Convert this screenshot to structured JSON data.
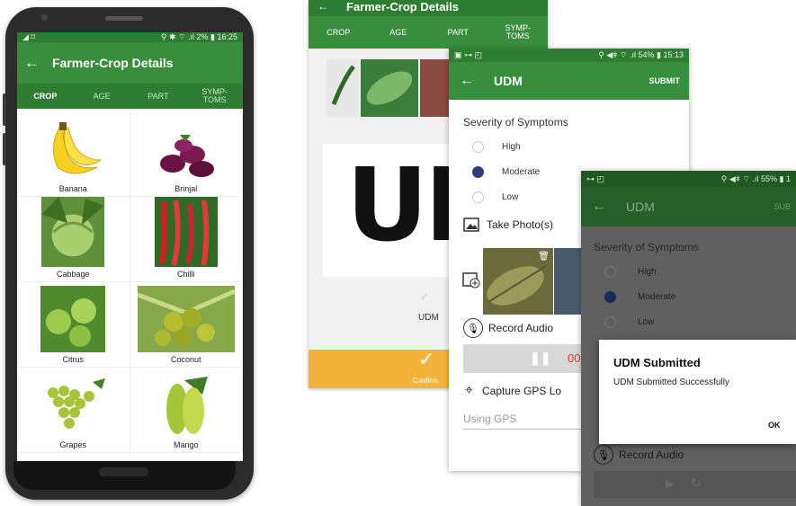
{
  "phone": {
    "status_left": "◢ ⌑",
    "status_right": "⚲ ✱ ⌔ .ıl 2% ▮ 16:25",
    "title": "Farmer-Crop Details",
    "back": "←",
    "tabs": [
      "CROP",
      "AGE",
      "PART",
      "SYMP-\nTOMS"
    ],
    "crops": [
      {
        "label": "Banana",
        "icon": "banana-icon"
      },
      {
        "label": "Brinjal",
        "icon": "brinjal-icon"
      },
      {
        "label": "Cabbage",
        "icon": "cabbage-icon"
      },
      {
        "label": "Chilli",
        "icon": "chilli-icon"
      },
      {
        "label": "Citrus",
        "icon": "citrus-icon"
      },
      {
        "label": "Coconut",
        "icon": "coconut-icon"
      },
      {
        "label": "Grapes",
        "icon": "grapes-icon"
      },
      {
        "label": "Mango",
        "icon": "mango-icon"
      }
    ]
  },
  "screen2": {
    "title": "Farmer-Crop Details",
    "back": "←",
    "tabs": [
      "CROP",
      "AGE",
      "PART",
      "SYMP-\nTOMS"
    ],
    "big_text": "UD",
    "udm_label": "UDM",
    "check": "✓",
    "confirm": "Confirm"
  },
  "screen3": {
    "status_left": "▣ ⊶ ◰",
    "status_right": "⚲ ◀ǂ ⌔ .ıl 54% ▮ 15:13",
    "back": "←",
    "title": "UDM",
    "submit": "SUBMIT",
    "severity_label": "Severity of Symptoms",
    "options": [
      "High",
      "Moderate",
      "Low"
    ],
    "selected": "Moderate",
    "take_photo": "Take Photo(s)",
    "record_audio": "Record Audio",
    "audio_time": "00",
    "capture_gps": "Capture GPS Lo",
    "gps_placeholder": "Using GPS"
  },
  "screen4": {
    "status_left": "⊶ ◰",
    "status_right": "⚲ ◀ǂ ⌔ .ıl 55% ▮ 1",
    "back": "←",
    "title": "UDM",
    "submit": "SUB",
    "severity_label": "Severity of Symptoms",
    "options": [
      "High",
      "Moderate",
      "Low"
    ],
    "selected": "Moderate",
    "record_audio": "Record Audio",
    "dialog": {
      "title": "UDM Submitted",
      "message": "UDM Submitted Successfully",
      "ok": "OK"
    }
  },
  "colors": {
    "green_dark": "#2e7d32",
    "green": "#388e3c",
    "orange": "#f4b43c",
    "red": "#e53935"
  }
}
